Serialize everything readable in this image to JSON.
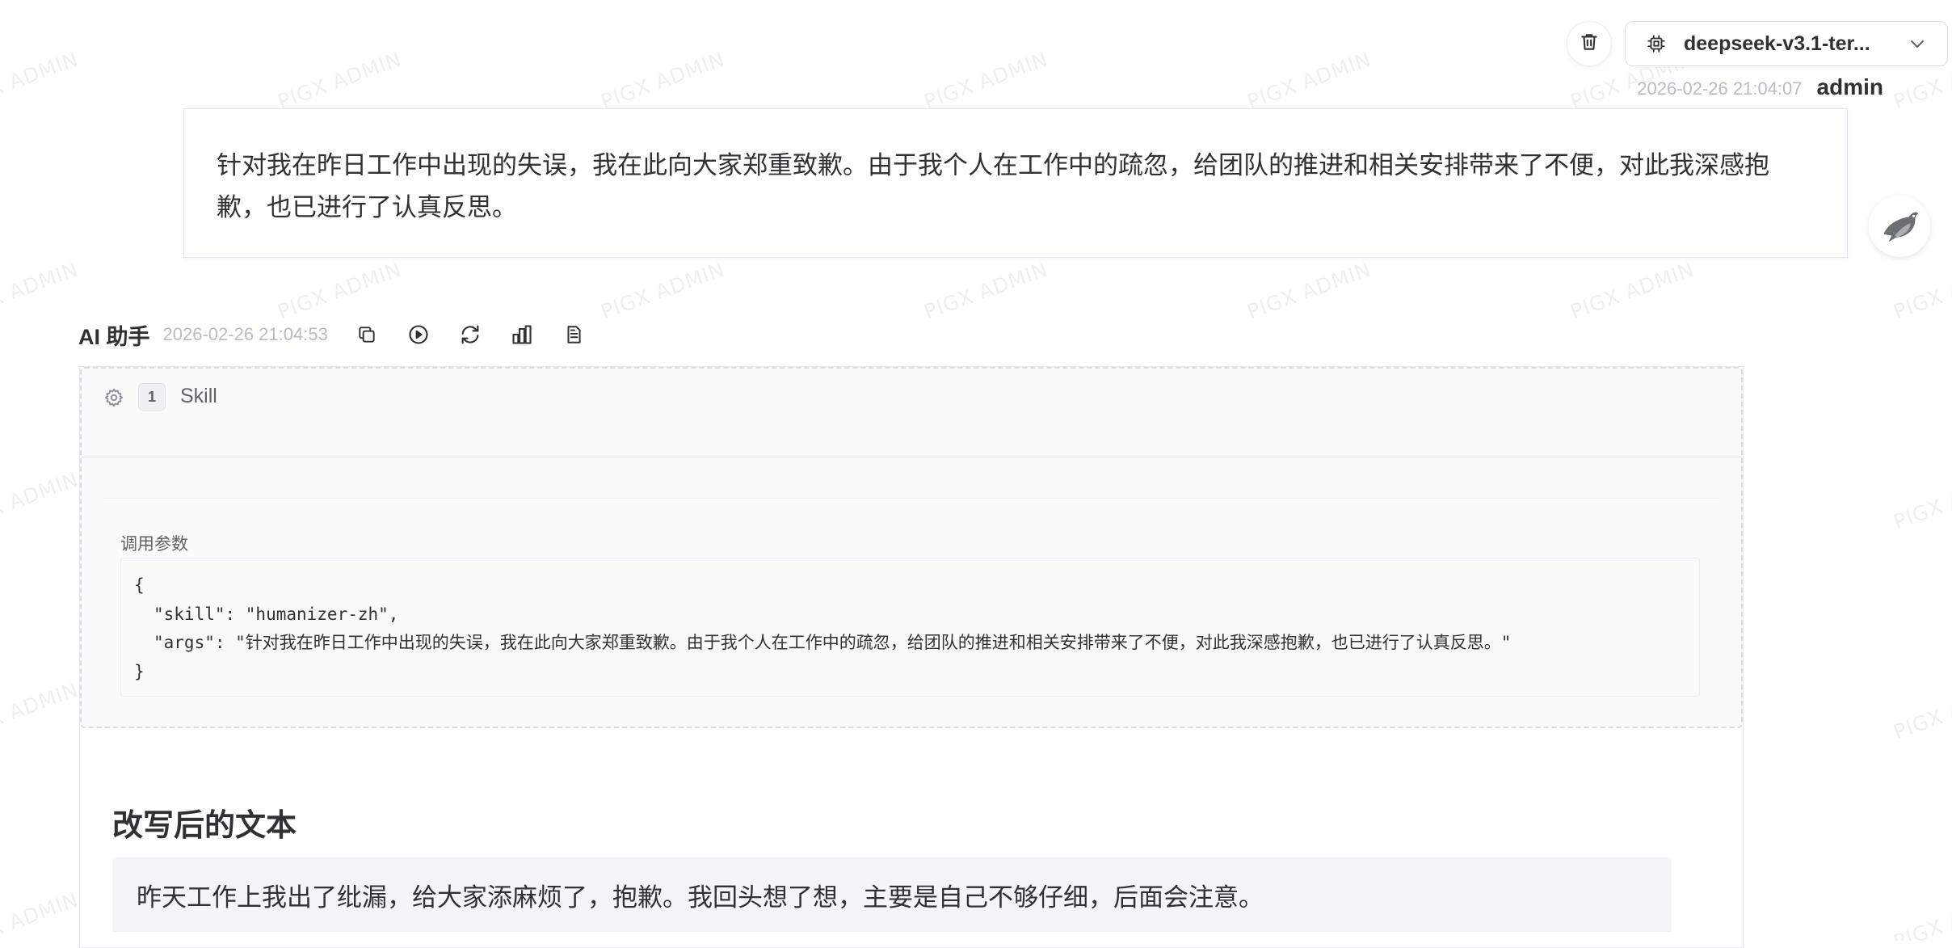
{
  "watermark": {
    "text": "PIGX ADMIN"
  },
  "header": {
    "model_select": {
      "value": "deepseek-v3.1-ter..."
    }
  },
  "user_message": {
    "timestamp": "2026-02-26 21:04:07",
    "author": "admin",
    "text": "针对我在昨日工作中出现的失误，我在此向大家郑重致歉。由于我个人在工作中的疏忽，给团队的推进和相关安排带来了不便，对此我深感抱歉，也已进行了认真反思。"
  },
  "ai_message": {
    "author": "AI 助手",
    "timestamp": "2026-02-26 21:04:53",
    "tool_call": {
      "index": "1",
      "label": "Skill",
      "params_label": "调用参数",
      "code_lines": [
        "{",
        "\"skill\": \"humanizer-zh\",",
        "\"args\": \"针对我在昨日工作中出现的失误，我在此向大家郑重致歉。由于我个人在工作中的疏忽，给团队的推进和相关安排带来了不便，对此我深感抱歉，也已进行了认真反思。\"",
        "}"
      ]
    },
    "result_heading": "改写后的文本",
    "result_text": "昨天工作上我出了纰漏，给大家添麻烦了，抱歉。我回头想了想，主要是自己不够仔细，后面会注意。"
  },
  "colors": {
    "text_primary": "#303133",
    "text_muted": "#b8bcc4",
    "border": "#e4e7ed",
    "code_bg": "#fafafa",
    "quote_bg": "#f4f5f7"
  }
}
